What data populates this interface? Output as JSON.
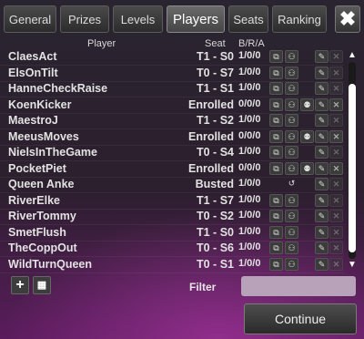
{
  "tabs": [
    {
      "label": "General"
    },
    {
      "label": "Prizes"
    },
    {
      "label": "Levels"
    },
    {
      "label": "Players"
    },
    {
      "label": "Seats"
    },
    {
      "label": "Ranking"
    }
  ],
  "active_tab": "Players",
  "close_label": "✖",
  "columns": {
    "player": "Player",
    "seat": "Seat",
    "bra": "B/R/A"
  },
  "players": [
    {
      "name": "ClaesAct",
      "seat": "T1 - S0",
      "bra": "1/0/0",
      "kick": false
    },
    {
      "name": "ElsOnTilt",
      "seat": "T0 - S7",
      "bra": "1/0/0",
      "kick": false
    },
    {
      "name": "HanneCheckRaise",
      "seat": "T1 - S1",
      "bra": "1/0/0",
      "kick": false
    },
    {
      "name": "KoenKicker",
      "seat": "Enrolled",
      "bra": "0/0/0",
      "kick": true
    },
    {
      "name": "MaestroJ",
      "seat": "T1 - S2",
      "bra": "1/0/0",
      "kick": false
    },
    {
      "name": "MeeusMoves",
      "seat": "Enrolled",
      "bra": "0/0/0",
      "kick": true
    },
    {
      "name": "NielsInTheGame",
      "seat": "T0 - S4",
      "bra": "1/0/0",
      "kick": false
    },
    {
      "name": "PocketPiet",
      "seat": "Enrolled",
      "bra": "0/0/0",
      "kick": true
    },
    {
      "name": "Queen Anke",
      "seat": "Busted",
      "bra": "1/0/0",
      "kick": false,
      "busted": true
    },
    {
      "name": "RiverElke",
      "seat": "T1 - S7",
      "bra": "1/0/0",
      "kick": false
    },
    {
      "name": "RiverTommy",
      "seat": "T0 - S2",
      "bra": "1/0/0",
      "kick": false
    },
    {
      "name": "SmetFlush",
      "seat": "T1 - S0",
      "bra": "1/0/0",
      "kick": false
    },
    {
      "name": "TheCoppOut",
      "seat": "T0 - S6",
      "bra": "1/0/0",
      "kick": false
    },
    {
      "name": "WildTurnQueen",
      "seat": "T0 - S1",
      "bra": "1/0/0",
      "kick": false
    }
  ],
  "icons": {
    "tables": "table-icon",
    "player": "player-icon",
    "kick": "kick-icon",
    "edit": "pencil-icon",
    "remove": "remove-icon",
    "undo": "undo-icon"
  },
  "filter": {
    "label": "Filter",
    "value": ""
  },
  "continue_label": "Continue"
}
